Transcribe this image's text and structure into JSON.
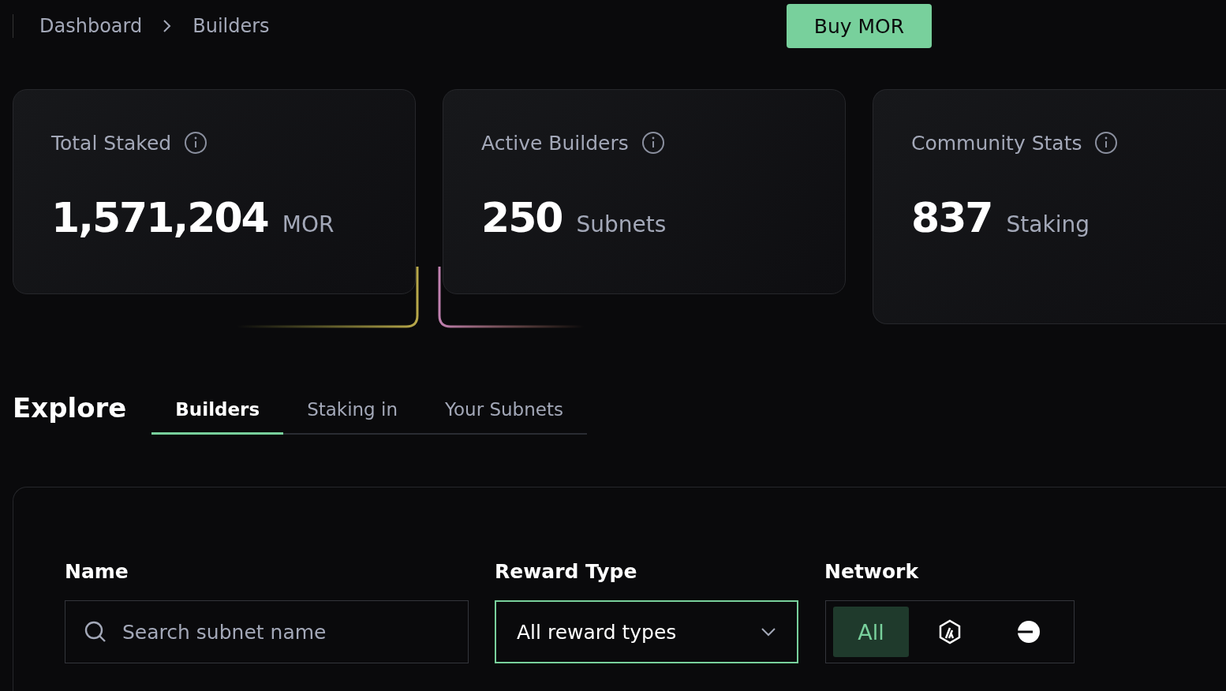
{
  "breadcrumb": [
    "Dashboard",
    "Builders"
  ],
  "buy_button": "Buy MOR",
  "stats": [
    {
      "title": "Total Staked",
      "value": "1,571,204",
      "unit": "MOR"
    },
    {
      "title": "Active Builders",
      "value": "250",
      "unit": "Subnets"
    },
    {
      "title": "Community Stats",
      "value": "837",
      "unit": "Staking"
    }
  ],
  "explore": {
    "title": "Explore",
    "tabs": [
      {
        "label": "Builders",
        "selected": true
      },
      {
        "label": "Staking in",
        "selected": false
      },
      {
        "label": "Your Subnets",
        "selected": false
      }
    ]
  },
  "filters": {
    "name": {
      "label": "Name",
      "placeholder": "Search subnet name"
    },
    "reward_type": {
      "label": "Reward Type",
      "value": "All reward types",
      "focused": true
    },
    "network": {
      "label": "Network",
      "options": [
        {
          "kind": "text",
          "label": "All",
          "selected": true
        },
        {
          "kind": "hexagon",
          "selected": false
        },
        {
          "kind": "disc",
          "selected": false
        }
      ]
    }
  }
}
